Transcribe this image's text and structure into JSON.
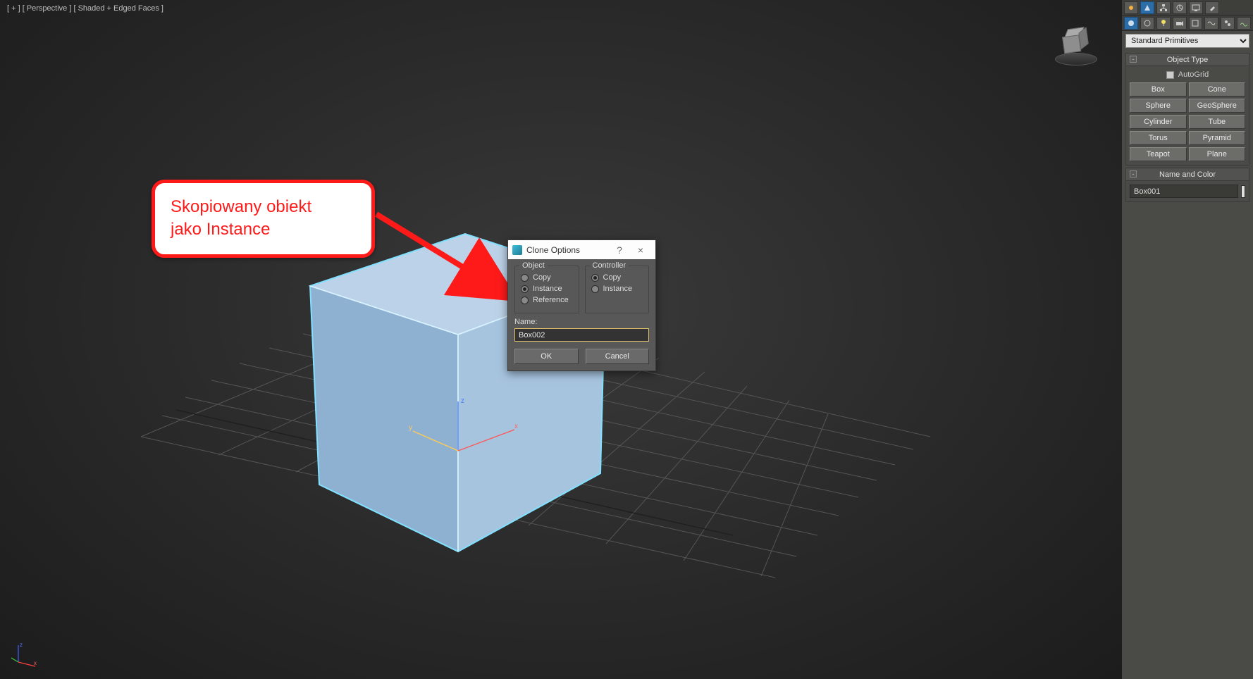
{
  "viewport": {
    "label": "[ + ] [ Perspective ] [ Shaded + Edged Faces ]"
  },
  "callout": {
    "line1": "Skopiowany obiekt",
    "line2": "jako Instance"
  },
  "dialog": {
    "title": "Clone Options",
    "help": "?",
    "close": "×",
    "object": {
      "legend": "Object",
      "copy": "Copy",
      "instance": "Instance",
      "reference": "Reference",
      "selected": "instance"
    },
    "controller": {
      "legend": "Controller",
      "copy": "Copy",
      "instance": "Instance",
      "selected": "copy"
    },
    "name_label": "Name:",
    "name_value": "Box002",
    "ok": "OK",
    "cancel": "Cancel"
  },
  "panel": {
    "dropdown": "Standard Primitives",
    "object_type": {
      "title": "Object Type",
      "autogrid": "AutoGrid",
      "buttons": [
        "Box",
        "Cone",
        "Sphere",
        "GeoSphere",
        "Cylinder",
        "Tube",
        "Torus",
        "Pyramid",
        "Teapot",
        "Plane"
      ]
    },
    "name_color": {
      "title": "Name and Color",
      "value": "Box001"
    },
    "icons_row1": [
      "sun-icon",
      "create-icon",
      "hierarchy-icon",
      "motion-icon",
      "display-icon",
      "utilities-icon",
      "tool-icon"
    ],
    "icons_row2": [
      "geometry-icon",
      "shapes-icon",
      "lights-icon",
      "cameras-icon",
      "helpers-icon",
      "spacewarps-icon",
      "systems-icon",
      "extra-icon"
    ]
  }
}
